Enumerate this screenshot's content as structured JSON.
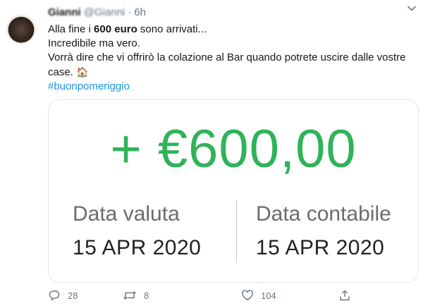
{
  "tweet": {
    "author_name": "Gianni",
    "handle": "@Gianni",
    "separator": "·",
    "time": "6h",
    "text": {
      "line1_prefix": "Alla fine i ",
      "line1_bold": "600 euro",
      "line1_suffix": " sono arrivati...",
      "line2": "Incredibile ma vero.",
      "line3": "Vorrà dire che vi offrirò la colazione al Bar quando potrete uscire dalle vostre case.",
      "hashtag": "#buonpomeriggio"
    },
    "emoji": "🏠"
  },
  "card": {
    "amount": "+ €600,00",
    "left_label": "Data valuta",
    "left_date": "15 APR 2020",
    "right_label": "Data contabile",
    "right_date": "15 APR 2020",
    "amount_color": "#2fb35a"
  },
  "actions": {
    "reply_count": "28",
    "retweet_count": "8",
    "like_count": "104"
  },
  "icons": [
    "chevron-down-icon",
    "reply-icon",
    "retweet-icon",
    "heart-icon",
    "share-icon"
  ],
  "colors": {
    "text": "#14171a",
    "secondary": "#657786",
    "link": "#1b95e0",
    "card_border": "#e1e8ed"
  }
}
